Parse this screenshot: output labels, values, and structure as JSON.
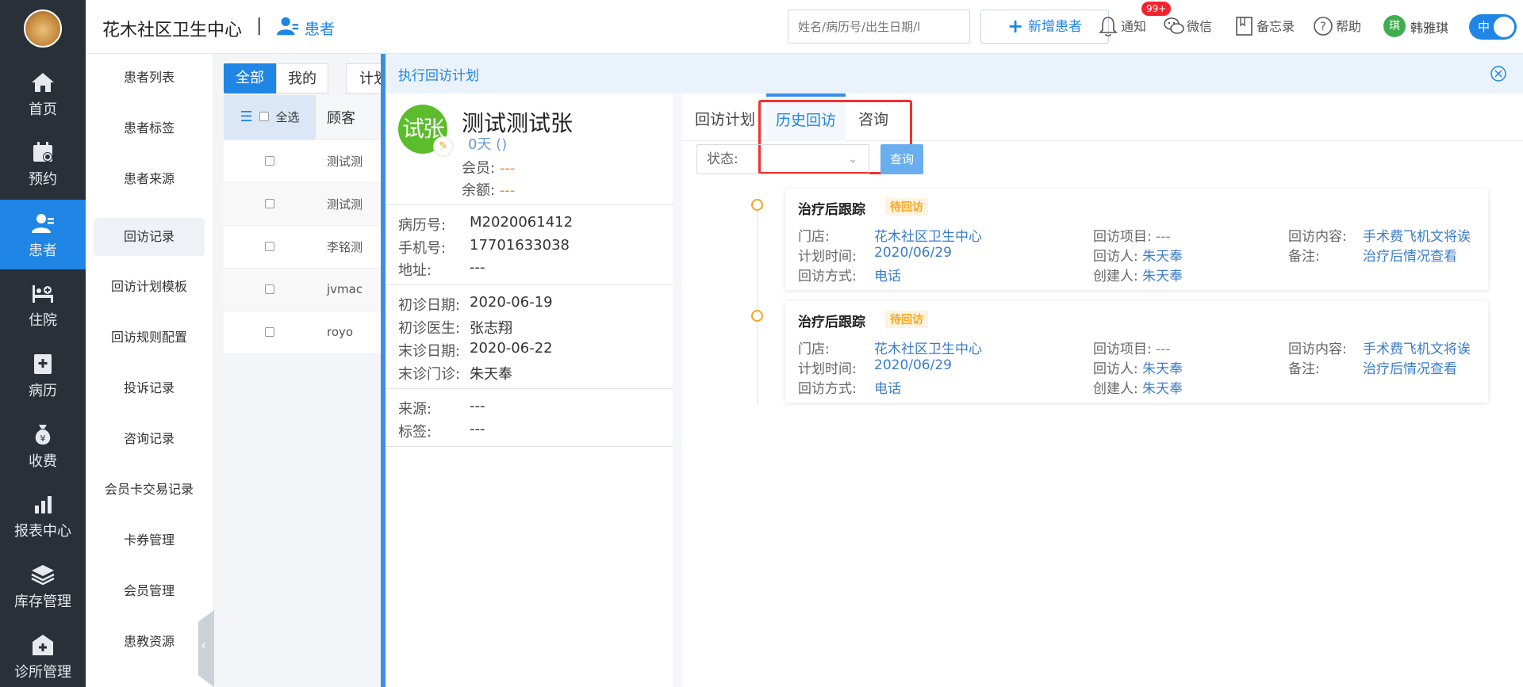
{
  "nav": {
    "items": [
      {
        "label": "首页",
        "icon": "home-icon"
      },
      {
        "label": "预约",
        "icon": "calendar-icon"
      },
      {
        "label": "患者",
        "icon": "patient-icon"
      },
      {
        "label": "住院",
        "icon": "bed-icon"
      },
      {
        "label": "病历",
        "icon": "medical-record-icon"
      },
      {
        "label": "收费",
        "icon": "money-bag-icon"
      },
      {
        "label": "报表中心",
        "icon": "bar-chart-icon"
      },
      {
        "label": "库存管理",
        "icon": "layers-icon"
      },
      {
        "label": "诊所管理",
        "icon": "clinic-icon"
      }
    ],
    "active": "患者"
  },
  "topbar": {
    "clinic_name": "花木社区卫生中心",
    "separator": "|",
    "module": "患者",
    "search_placeholder": "姓名/病历号/出生日期/l",
    "add_patient": "新增患者",
    "notify": "通知",
    "notify_badge": "99+",
    "wechat": "微信",
    "memo": "备忘录",
    "help": "帮助",
    "user_initial": "琪",
    "user_name": "韩雅琪",
    "lang": "中"
  },
  "submenu": {
    "items": [
      "患者列表",
      "患者标签",
      "患者来源",
      "回访记录",
      "回访计划模板",
      "回访规则配置",
      "投诉记录",
      "咨询记录",
      "会员卡交易记录",
      "卡券管理",
      "会员管理",
      "患教资源"
    ],
    "active": "回访记录"
  },
  "list": {
    "tab_all": "全部",
    "tab_mine": "我的",
    "tab_plan": "计划",
    "select_all": "全选",
    "col_customer": "顾客",
    "rows": [
      "测试测",
      "测试测",
      "李铭测",
      "jvmac",
      "royo"
    ]
  },
  "panel": {
    "title": "执行回访计划",
    "patient": {
      "avatar_text": "试张",
      "name": "测试测试张",
      "days": "0天 ()",
      "member_label": "会员:",
      "member_value": "---",
      "balance_label": "余额:",
      "balance_value": "---",
      "record_no_label": "病历号:",
      "record_no": "M2020061412",
      "phone_label": "手机号:",
      "phone": "17701633038",
      "address_label": "地址:",
      "address": "---",
      "first_visit_label": "初诊日期:",
      "first_visit": "2020-06-19",
      "first_doctor_label": "初诊医生:",
      "first_doctor": "张志翔",
      "last_visit_label": "末诊日期:",
      "last_visit": "2020-06-22",
      "last_clinic_label": "末诊门诊:",
      "last_clinic": "朱天奉",
      "source_label": "来源:",
      "source": "---",
      "tag_label": "标签:",
      "tag": "---"
    },
    "tabs": [
      "回访计划",
      "历史回访",
      "咨询"
    ],
    "active_tab": "历史回访",
    "status_label": "状态:",
    "query_button": "查询",
    "records": [
      {
        "title": "治疗后跟踪",
        "status": "待回访",
        "store_label": "门店:",
        "store": "花木社区卫生中心",
        "plan_time_label": "计划时间:",
        "plan_time": "2020/06/29",
        "method_label": "回访方式:",
        "method": "电话",
        "item_label": "回访项目:",
        "item": "---",
        "visitor_label": "回访人:",
        "visitor": "朱天奉",
        "creator_label": "创建人:",
        "creator": "朱天奉",
        "content_label": "回访内容:",
        "content": "手术费飞机文将诶",
        "note_label": "备注:",
        "note": "治疗后情况查看"
      },
      {
        "title": "治疗后跟踪",
        "status": "待回访",
        "store_label": "门店:",
        "store": "花木社区卫生中心",
        "plan_time_label": "计划时间:",
        "plan_time": "2020/06/29",
        "method_label": "回访方式:",
        "method": "电话",
        "item_label": "回访项目:",
        "item": "---",
        "visitor_label": "回访人:",
        "visitor": "朱天奉",
        "creator_label": "创建人:",
        "creator": "朱天奉",
        "content_label": "回访内容:",
        "content": "手术费飞机文将诶",
        "note_label": "备注:",
        "note": "治疗后情况查看"
      }
    ]
  },
  "colors": {
    "primary": "#1f86e5",
    "nav_bg": "#293038",
    "highlight_box": "#f23030",
    "pending": "#f5a623"
  }
}
